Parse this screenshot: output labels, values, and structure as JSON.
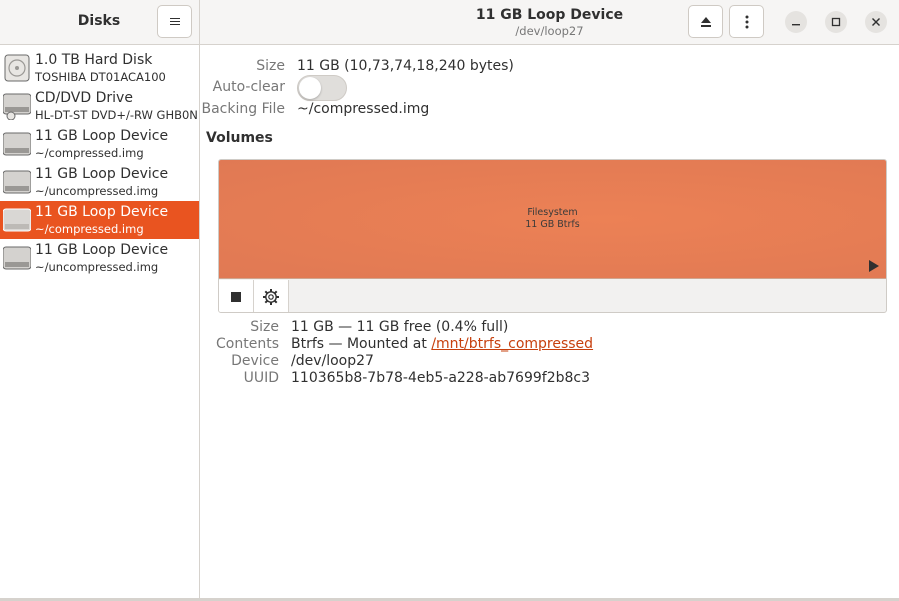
{
  "sidebar": {
    "title": "Disks",
    "devices": [
      {
        "name": "1.0 TB Hard Disk",
        "sub": "TOSHIBA DT01ACA100",
        "icon": "hard-disk-icon",
        "selected": false
      },
      {
        "name": "CD/DVD Drive",
        "sub": "HL-DT-ST DVD+/-RW GHB0N",
        "icon": "optical-drive-icon",
        "selected": false
      },
      {
        "name": "11 GB Loop Device",
        "sub": "~/compressed.img",
        "icon": "loop-device-icon",
        "selected": false
      },
      {
        "name": "11 GB Loop Device",
        "sub": "~/uncompressed.img",
        "icon": "loop-device-icon",
        "selected": false
      },
      {
        "name": "11 GB Loop Device",
        "sub": "~/compressed.img",
        "icon": "loop-device-icon",
        "selected": true
      },
      {
        "name": "11 GB Loop Device",
        "sub": "~/uncompressed.img",
        "icon": "loop-device-icon",
        "selected": false
      }
    ]
  },
  "header": {
    "title": "11 GB Loop Device",
    "subtitle": "/dev/loop27"
  },
  "device_props": {
    "size_label": "Size",
    "size_value": "11 GB (10,73,74,18,240 bytes)",
    "autoclear_label": "Auto-clear",
    "autoclear_on": false,
    "backing_label": "Backing File",
    "backing_value": "~/compressed.img"
  },
  "volumes": {
    "title": "Volumes",
    "partition": {
      "line1": "Filesystem",
      "line2": "11 GB Btrfs"
    }
  },
  "volume_props": {
    "size_label": "Size",
    "size_value": "11 GB — 11 GB free (0.4% full)",
    "contents_label": "Contents",
    "contents_prefix": "Btrfs — Mounted at ",
    "contents_link": "/mnt/btrfs_compressed",
    "device_label": "Device",
    "device_value": "/dev/loop27",
    "uuid_label": "UUID",
    "uuid_value": "110365b8-7b78-4eb5-a228-ab7699f2b8c3"
  },
  "colors": {
    "accent": "#e95420",
    "partition": "#e87a52",
    "link": "#c7400e"
  }
}
